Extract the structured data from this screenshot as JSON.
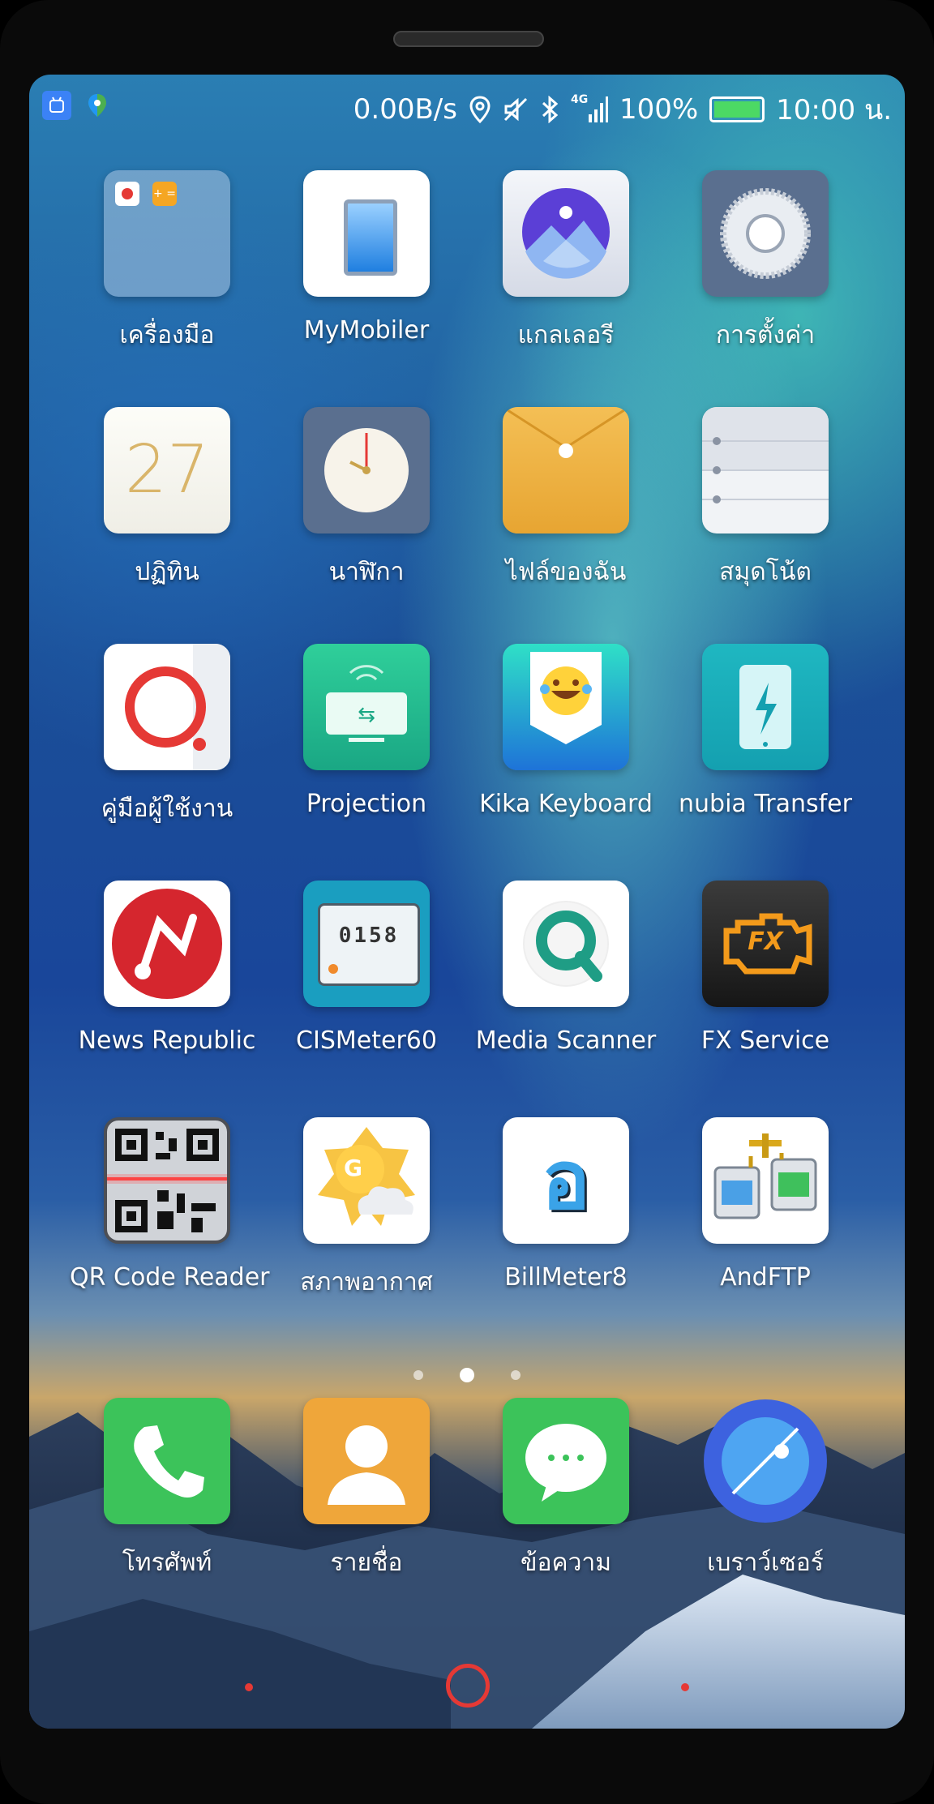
{
  "status_bar": {
    "speed": "0.00B/s",
    "network": "4G",
    "battery": "100%",
    "time": "10:00 น.",
    "battery_level": 1.0
  },
  "apps": [
    {
      "label": "เครื่องมือ",
      "icon": "tools-folder-icon"
    },
    {
      "label": "MyMobiler",
      "icon": "mymobiler-icon"
    },
    {
      "label": "แกลเลอรี",
      "icon": "gallery-icon"
    },
    {
      "label": "การตั้งค่า",
      "icon": "settings-icon"
    },
    {
      "label": "ปฏิทิน",
      "icon": "calendar-icon",
      "date": "27"
    },
    {
      "label": "นาฬิกา",
      "icon": "clock-icon"
    },
    {
      "label": "ไฟล์ของฉัน",
      "icon": "files-icon"
    },
    {
      "label": "สมุดโน้ต",
      "icon": "notes-icon"
    },
    {
      "label": "คู่มือผู้ใช้งาน",
      "icon": "user-guide-icon"
    },
    {
      "label": "Projection",
      "icon": "projection-icon"
    },
    {
      "label": "Kika Keyboard",
      "icon": "kika-keyboard-icon"
    },
    {
      "label": "nubia Transfer",
      "icon": "nubia-transfer-icon"
    },
    {
      "label": "News Republic",
      "icon": "news-republic-icon"
    },
    {
      "label": "CISMeter60",
      "icon": "cismeter-icon",
      "reading": "0158"
    },
    {
      "label": "Media Scanner",
      "icon": "media-scanner-icon"
    },
    {
      "label": "FX Service",
      "icon": "fx-service-icon",
      "badge": "FX"
    },
    {
      "label": "QR Code Reader",
      "icon": "qr-code-reader-icon"
    },
    {
      "label": "สภาพอากาศ",
      "icon": "weather-icon",
      "badge": "G"
    },
    {
      "label": "BillMeter8",
      "icon": "billmeter-icon",
      "glyph": "อ"
    },
    {
      "label": "AndFTP",
      "icon": "andftp-icon"
    }
  ],
  "dock": [
    {
      "label": "โทรศัพท์",
      "icon": "phone-icon"
    },
    {
      "label": "รายชื่อ",
      "icon": "contacts-icon"
    },
    {
      "label": "ข้อความ",
      "icon": "messages-icon"
    },
    {
      "label": "เบราว์เซอร์",
      "icon": "browser-icon"
    }
  ],
  "page_indicator": {
    "count": 3,
    "active": 2
  }
}
